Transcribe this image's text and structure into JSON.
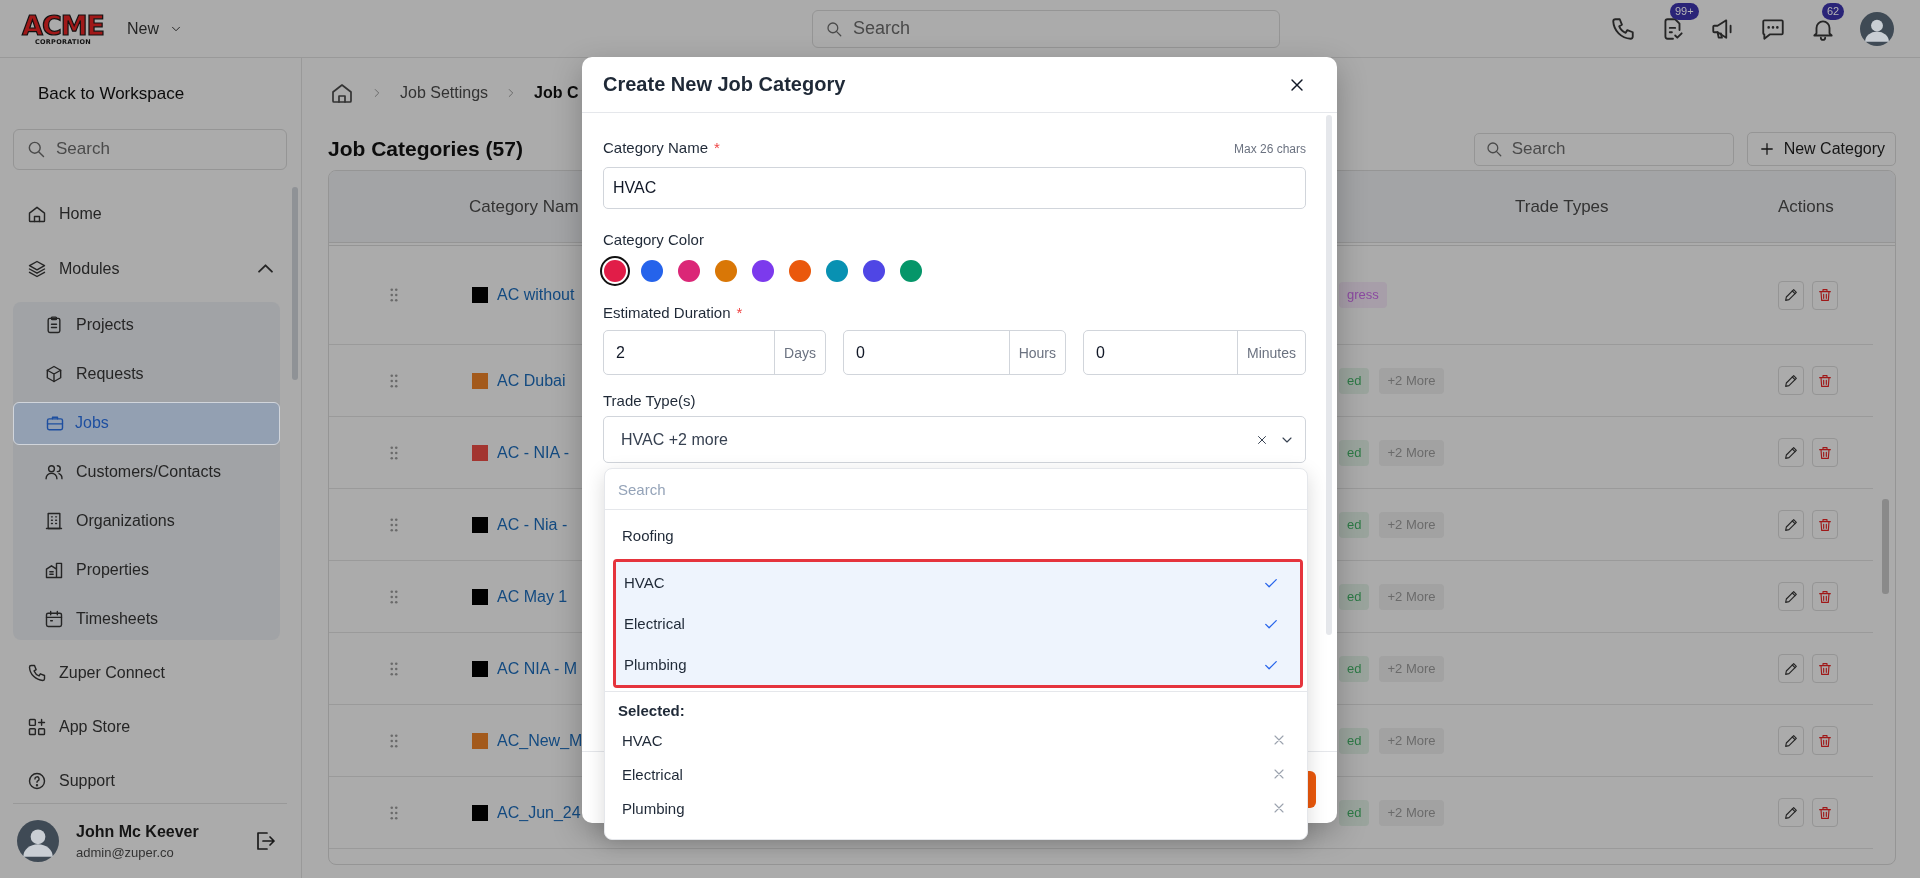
{
  "topbar": {
    "logo": {
      "line_1": "ACME",
      "line_2": "CORPORATION"
    },
    "new_menu": "New",
    "search": {
      "placeholder": "Search"
    },
    "tasks_badge": "99+",
    "bell_badge": "62"
  },
  "sidebar": {
    "back": "Back to Workspace",
    "search": {
      "placeholder": "Search"
    },
    "items": [
      {
        "label": "Home",
        "selected": false
      },
      {
        "label": "Modules",
        "selected": false,
        "expanded": true,
        "children": [
          {
            "label": "Projects",
            "selected": false
          },
          {
            "label": "Requests",
            "selected": false
          },
          {
            "label": "Jobs",
            "selected": true
          },
          {
            "label": "Customers/Contacts",
            "selected": false
          },
          {
            "label": "Organizations",
            "selected": false
          },
          {
            "label": "Properties",
            "selected": false
          },
          {
            "label": "Timesheets",
            "selected": false
          }
        ]
      },
      {
        "label": "Zuper Connect",
        "selected": false
      },
      {
        "label": "App Store",
        "selected": false
      },
      {
        "label": "Support",
        "selected": false
      }
    ],
    "user": {
      "name": "John Mc Keever",
      "email": "admin@zuper.co"
    }
  },
  "page": {
    "breadcrumb": [
      "Job Settings",
      "Job C"
    ],
    "title": "Job Categories (57)",
    "search": {
      "placeholder": "Search"
    },
    "new_button": "New Category",
    "table": {
      "columns": [
        "Category Nam",
        "Trade Types",
        "Actions"
      ],
      "rows": [
        {
          "name": "AC without",
          "color": "#000000",
          "tags": [
            {
              "label": "gress",
              "color": "#8b4aa0"
            }
          ]
        },
        {
          "name": "AC Dubai",
          "color": "#a35a1c",
          "tags": [
            {
              "label": "ed",
              "color": "#2d7a46"
            },
            {
              "label": "+2 More",
              "color": "#6b6b6b"
            }
          ]
        },
        {
          "name": "AC - NIA -",
          "color": "#a33530",
          "tags": [
            {
              "label": "ed",
              "color": "#2d7a46"
            },
            {
              "label": "+2 More",
              "color": "#6b6b6b"
            }
          ]
        },
        {
          "name": "AC - Nia -",
          "color": "#000000",
          "tags": [
            {
              "label": "ed",
              "color": "#2d7a46"
            },
            {
              "label": "+2 More",
              "color": "#6b6b6b"
            }
          ]
        },
        {
          "name": "AC May 1",
          "color": "#000000",
          "tags": [
            {
              "label": "ed",
              "color": "#2d7a46"
            },
            {
              "label": "+2 More",
              "color": "#6b6b6b"
            }
          ]
        },
        {
          "name": "AC NIA - M",
          "color": "#000000",
          "tags": [
            {
              "label": "ed",
              "color": "#2d7a46"
            },
            {
              "label": "+2 More",
              "color": "#6b6b6b"
            }
          ]
        },
        {
          "name": "AC_New_M",
          "color": "#a35a1c",
          "tags": [
            {
              "label": "ed",
              "color": "#2d7a46"
            },
            {
              "label": "+2 More",
              "color": "#6b6b6b"
            }
          ]
        },
        {
          "name": "AC_Jun_24",
          "color": "#000000",
          "tags": [
            {
              "label": "ed",
              "color": "#2d7a46"
            },
            {
              "label": "+2 More",
              "color": "#6b6b6b"
            }
          ]
        }
      ]
    }
  },
  "modal": {
    "title": "Create New Job Category",
    "name_field": {
      "label": "Category Name",
      "required_mark": "*",
      "hint": "Max 26 chars",
      "value": "HVAC"
    },
    "color_field": {
      "label": "Category Color",
      "colors": [
        {
          "color": "#e11d48",
          "selected": true
        },
        {
          "color": "#2563eb",
          "selected": false
        },
        {
          "color": "#db2777",
          "selected": false
        },
        {
          "color": "#d97706",
          "selected": false
        },
        {
          "color": "#7c3aed",
          "selected": false
        },
        {
          "color": "#ea580c",
          "selected": false
        },
        {
          "color": "#0891b2",
          "selected": false
        },
        {
          "color": "#4f46e5",
          "selected": false
        },
        {
          "color": "#059669",
          "selected": false
        }
      ]
    },
    "duration_field": {
      "label": "Estimated Duration",
      "required_mark": "*",
      "parts": [
        {
          "value": "2",
          "unit": "Days"
        },
        {
          "value": "0",
          "unit": "Hours"
        },
        {
          "value": "0",
          "unit": "Minutes"
        }
      ]
    },
    "trade_field": {
      "label": "Trade Type(s)",
      "value": "HVAC +2 more",
      "dropdown": {
        "search": {
          "placeholder": "Search"
        },
        "options": [
          {
            "label": "Roofing",
            "selected": false
          },
          {
            "label": "HVAC",
            "selected": true
          },
          {
            "label": "Electrical",
            "selected": true
          },
          {
            "label": "Plumbing",
            "selected": true
          }
        ],
        "selected_heading": "Selected:",
        "selected_items": [
          "HVAC",
          "Electrical",
          "Plumbing"
        ]
      }
    }
  }
}
